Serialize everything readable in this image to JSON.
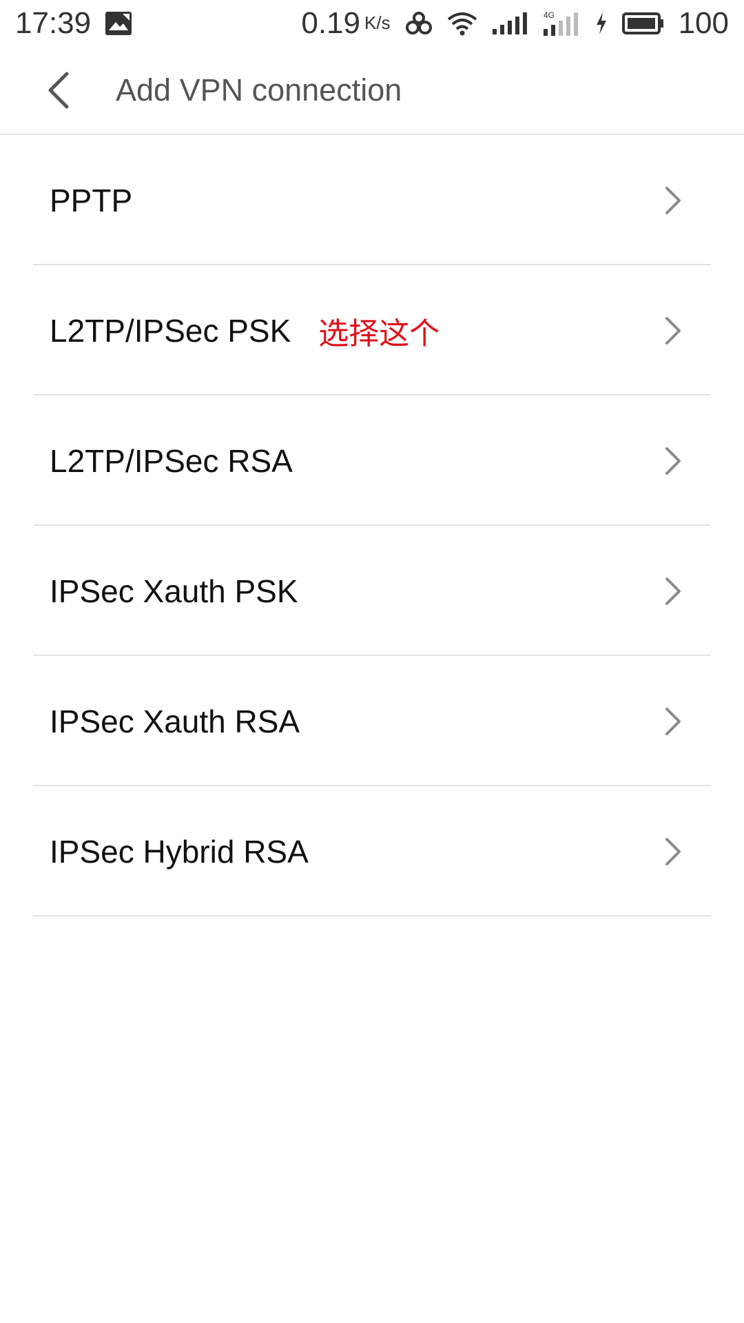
{
  "status_bar": {
    "time": "17:39",
    "net_speed_value": "0.19",
    "net_speed_unit": "K/s",
    "battery_level": "100",
    "icons": [
      "image-notification-icon",
      "link-icon",
      "wifi-icon",
      "signal-icon",
      "signal-4g-icon",
      "charging-icon",
      "battery-icon"
    ]
  },
  "header": {
    "title": "Add VPN connection",
    "back_icon": "chevron-left-icon"
  },
  "vpn_types": [
    {
      "label": "PPTP",
      "annotation": ""
    },
    {
      "label": "L2TP/IPSec PSK",
      "annotation": "选择这个"
    },
    {
      "label": "L2TP/IPSec RSA",
      "annotation": ""
    },
    {
      "label": "IPSec Xauth PSK",
      "annotation": ""
    },
    {
      "label": "IPSec Xauth RSA",
      "annotation": ""
    },
    {
      "label": "IPSec Hybrid RSA",
      "annotation": ""
    }
  ],
  "colors": {
    "annotation": "#e0101a",
    "divider": "#e4e4e4",
    "chevron": "#8a8a8a"
  }
}
